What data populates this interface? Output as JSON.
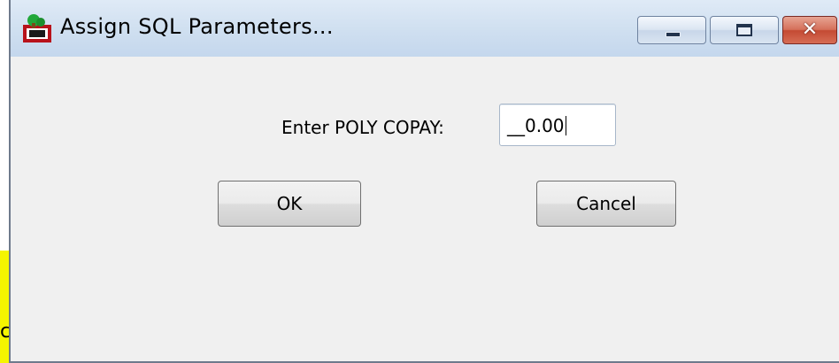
{
  "window": {
    "title": "Assign SQL Parameters...",
    "controls": {
      "close_glyph": "✕"
    }
  },
  "form": {
    "prompt_label": "Enter POLY COPAY:",
    "input_value": "__0.00"
  },
  "buttons": {
    "ok_label": "OK",
    "cancel_label": "Cancel"
  },
  "background": {
    "partial_char": "c"
  }
}
